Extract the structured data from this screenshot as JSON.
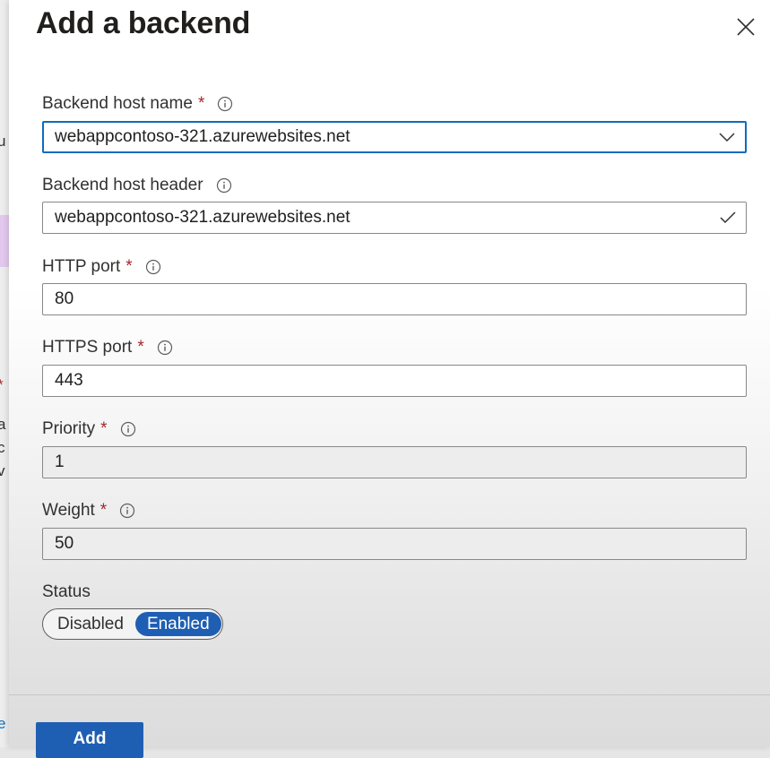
{
  "panel": {
    "title": "Add a backend"
  },
  "fields": {
    "host_name": {
      "label": "Backend host name",
      "required": "*",
      "value": "webappcontoso-321.azurewebsites.net"
    },
    "host_header": {
      "label": "Backend host header",
      "value": "webappcontoso-321.azurewebsites.net"
    },
    "http_port": {
      "label": "HTTP port",
      "required": "*",
      "value": "80"
    },
    "https_port": {
      "label": "HTTPS port",
      "required": "*",
      "value": "443"
    },
    "priority": {
      "label": "Priority",
      "required": "*",
      "value": "1"
    },
    "weight": {
      "label": "Weight",
      "required": "*",
      "value": "50"
    }
  },
  "status": {
    "label": "Status",
    "options": [
      "Disabled",
      "Enabled"
    ],
    "selected": "Enabled"
  },
  "footer": {
    "add_label": "Add"
  },
  "background_fragments": {
    "f1": "u",
    "f2": "*",
    "f3": "a",
    "f4": "c",
    "f5": "v",
    "f6": "e"
  },
  "colors": {
    "accent": "#1f5fb3",
    "focus_border": "#0f6cbd",
    "required": "#a4262c"
  },
  "icons": {
    "close": "close-icon",
    "info": "info-icon",
    "dropdown": "chevron-down-icon",
    "valid": "checkmark-icon"
  }
}
